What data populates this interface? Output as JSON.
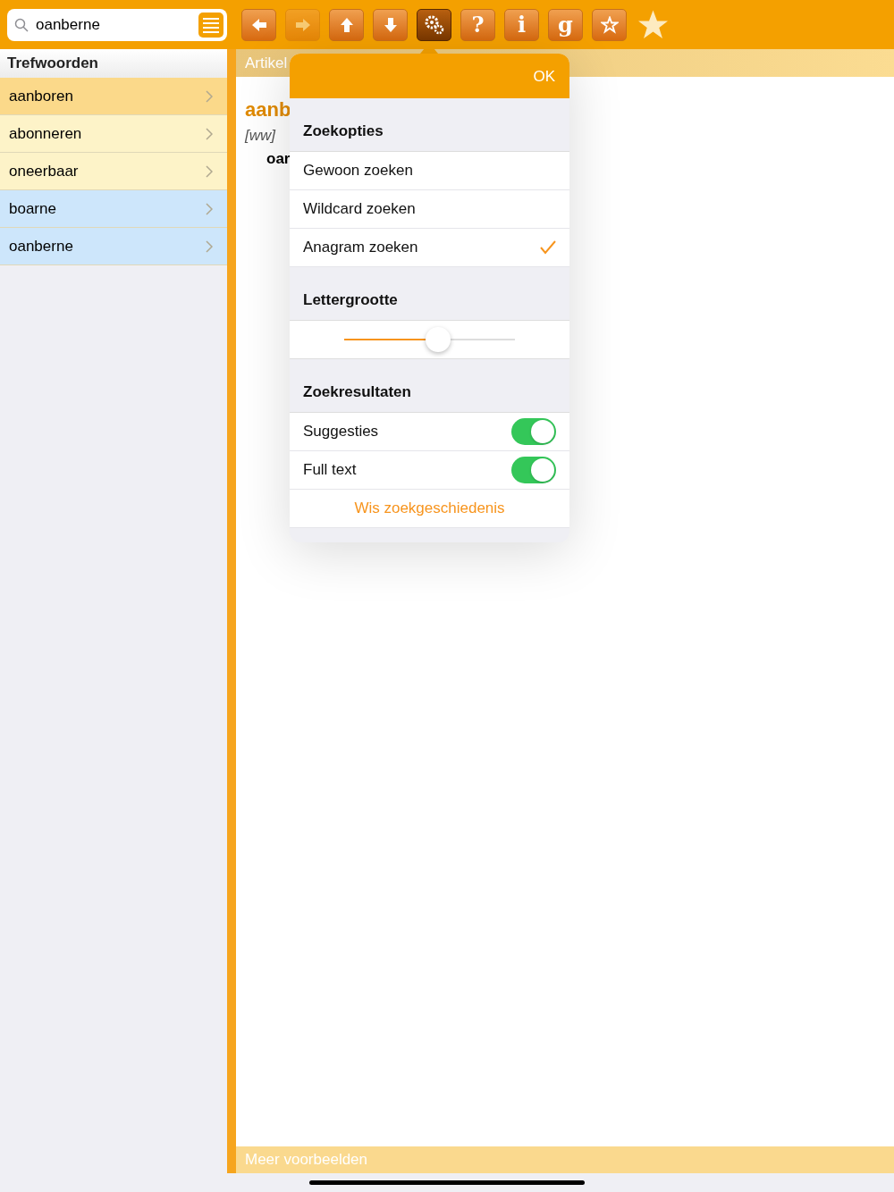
{
  "search": {
    "value": "oanberne"
  },
  "toolbar": [
    {
      "kind": "arrow-left",
      "disabled": false,
      "selected": false
    },
    {
      "kind": "arrow-right",
      "disabled": true,
      "selected": false
    },
    {
      "kind": "arrow-up",
      "disabled": false,
      "selected": false
    },
    {
      "kind": "arrow-down",
      "disabled": false,
      "selected": false
    },
    {
      "kind": "gears",
      "disabled": false,
      "selected": true
    },
    {
      "kind": "glyph",
      "label": "?",
      "disabled": false,
      "selected": false
    },
    {
      "kind": "glyph",
      "label": "i",
      "disabled": false,
      "selected": false
    },
    {
      "kind": "glyph",
      "label": "g",
      "disabled": false,
      "selected": false
    },
    {
      "kind": "star-outline",
      "disabled": false,
      "selected": false
    },
    {
      "kind": "star-plain",
      "disabled": false,
      "selected": false
    }
  ],
  "sidebar": {
    "title": "Trefwoorden",
    "items": [
      {
        "label": "aanboren",
        "color": "#fbd98a"
      },
      {
        "label": "abonneren",
        "color": "#fdf3c8"
      },
      {
        "label": "oneerbaar",
        "color": "#fdf3c8"
      },
      {
        "label": "boarne",
        "color": "#cde6fb"
      },
      {
        "label": "oanberne",
        "color": "#cde6fb"
      }
    ]
  },
  "article": {
    "header": "Artikel",
    "headword": "aanb",
    "word_class": "[ww]",
    "translation": "oar",
    "footer": "Meer voorbeelden"
  },
  "popover": {
    "ok": "OK",
    "search_options": {
      "title": "Zoekopties",
      "items": [
        {
          "label": "Gewoon zoeken",
          "selected": false
        },
        {
          "label": "Wildcard zoeken",
          "selected": false
        },
        {
          "label": "Anagram zoeken",
          "selected": true
        }
      ]
    },
    "font_size": {
      "title": "Lettergrootte",
      "level": 0.55
    },
    "results": {
      "title": "Zoekresultaten",
      "toggles": [
        {
          "label": "Suggesties",
          "on": true
        },
        {
          "label": "Full text",
          "on": true
        }
      ],
      "action": "Wis zoekgeschiedenis"
    }
  }
}
